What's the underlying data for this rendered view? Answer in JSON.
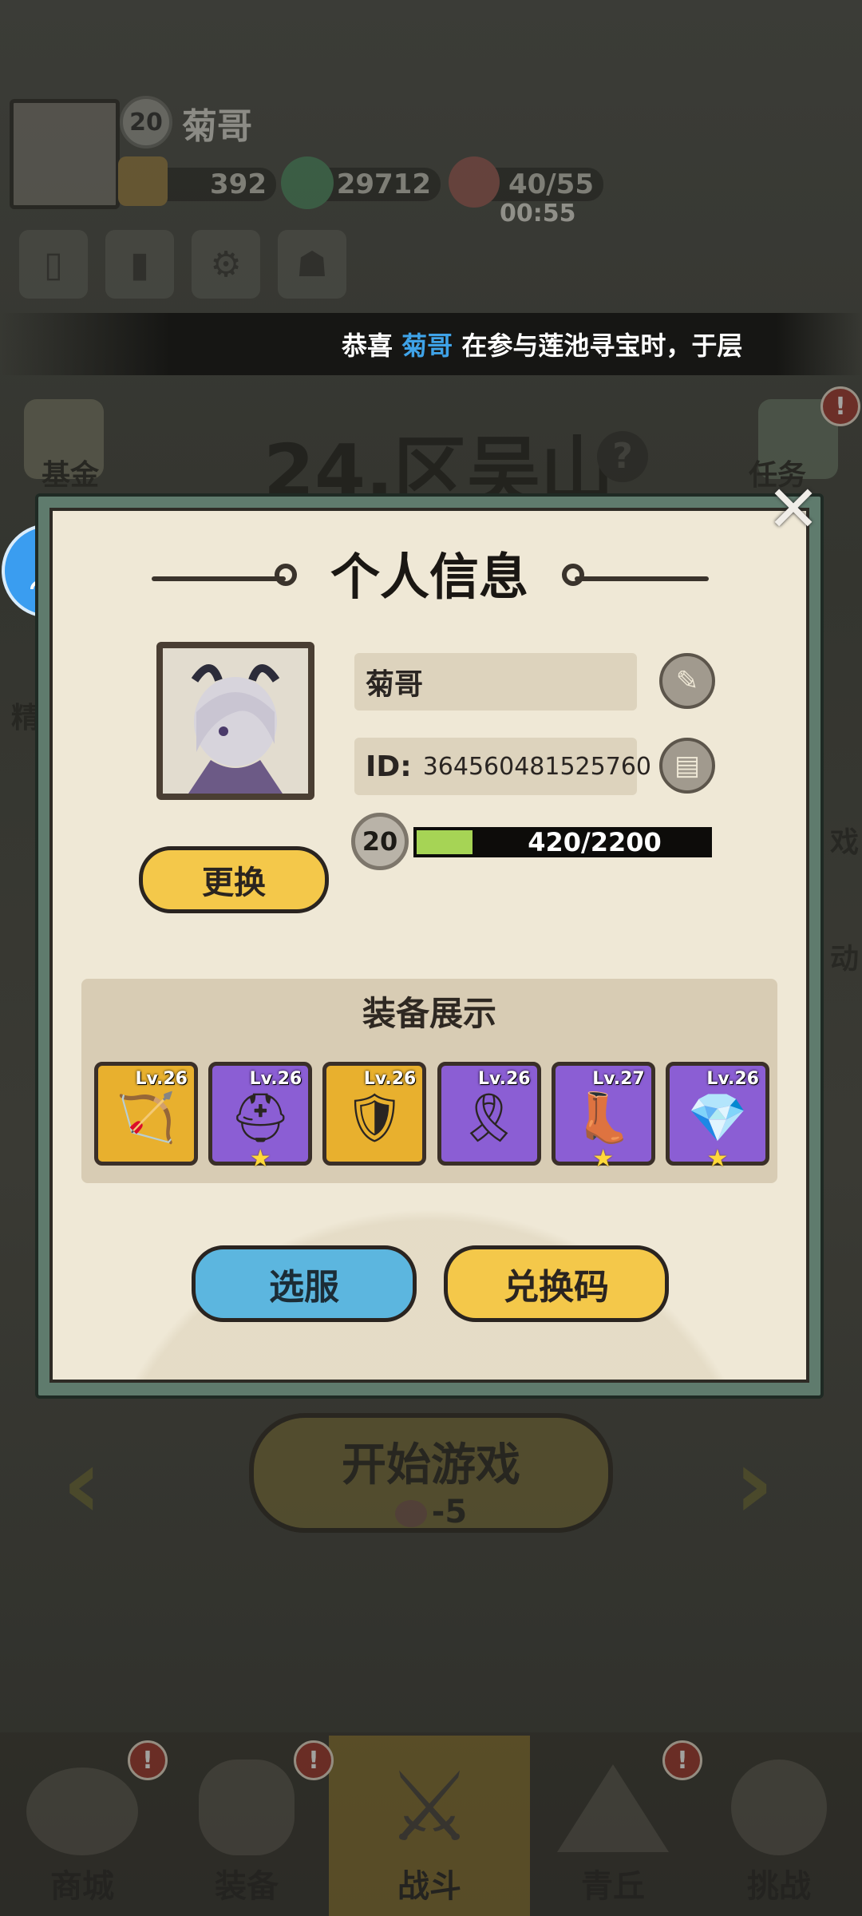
{
  "player": {
    "name": "菊哥",
    "level": "20",
    "gems": "392",
    "coins": "29712",
    "stamina": "40/55",
    "stamina_timer": "00:55"
  },
  "ticker": {
    "prefix": "恭喜",
    "name": "菊哥",
    "suffix": "在参与莲池寻宝时，于层"
  },
  "stage": {
    "title": "24.区吴山",
    "help": "?"
  },
  "side_left": {
    "fund": "基金",
    "elite": "精"
  },
  "side_right": {
    "tasks": "任务",
    "right_partial_1": "戏",
    "right_partial_2": "动"
  },
  "profile_dialog": {
    "title": "个人信息",
    "name_field": "菊哥",
    "id_label": "ID:",
    "id_value": "364560481525760",
    "level": "20",
    "exp_text": "420/2200",
    "exp_progress": 0.19,
    "change_avatar_button": "更换",
    "equip_title": "装备展示",
    "equipment": [
      {
        "level": "Lv.26",
        "rarity": "gold",
        "item": "bow",
        "star": false
      },
      {
        "level": "Lv.26",
        "rarity": "purple",
        "item": "helmet",
        "star": true
      },
      {
        "level": "Lv.26",
        "rarity": "gold",
        "item": "armor",
        "star": false
      },
      {
        "level": "Lv.26",
        "rarity": "purple",
        "item": "belt",
        "star": false
      },
      {
        "level": "Lv.27",
        "rarity": "purple",
        "item": "boots",
        "star": true
      },
      {
        "level": "Lv.26",
        "rarity": "purple",
        "item": "amulet",
        "star": true
      }
    ],
    "server_button": "选服",
    "redeem_button": "兑换码",
    "close": "✕"
  },
  "start_game": {
    "label": "开始游戏",
    "cost": "-5"
  },
  "bottom_nav": [
    {
      "label": "商城",
      "badge": "!"
    },
    {
      "label": "装备",
      "badge": "!"
    },
    {
      "label": "战斗",
      "badge": ""
    },
    {
      "label": "青丘",
      "badge": "!"
    },
    {
      "label": "挑战",
      "badge": ""
    }
  ],
  "colors": {
    "accent_blue": "#3fa3e8",
    "button_yellow": "#f4c84a",
    "button_blue": "#5cb6df",
    "exp_green": "#a6d455",
    "rarity_gold": "#e8b02e",
    "rarity_purple": "#8b5ed4"
  }
}
